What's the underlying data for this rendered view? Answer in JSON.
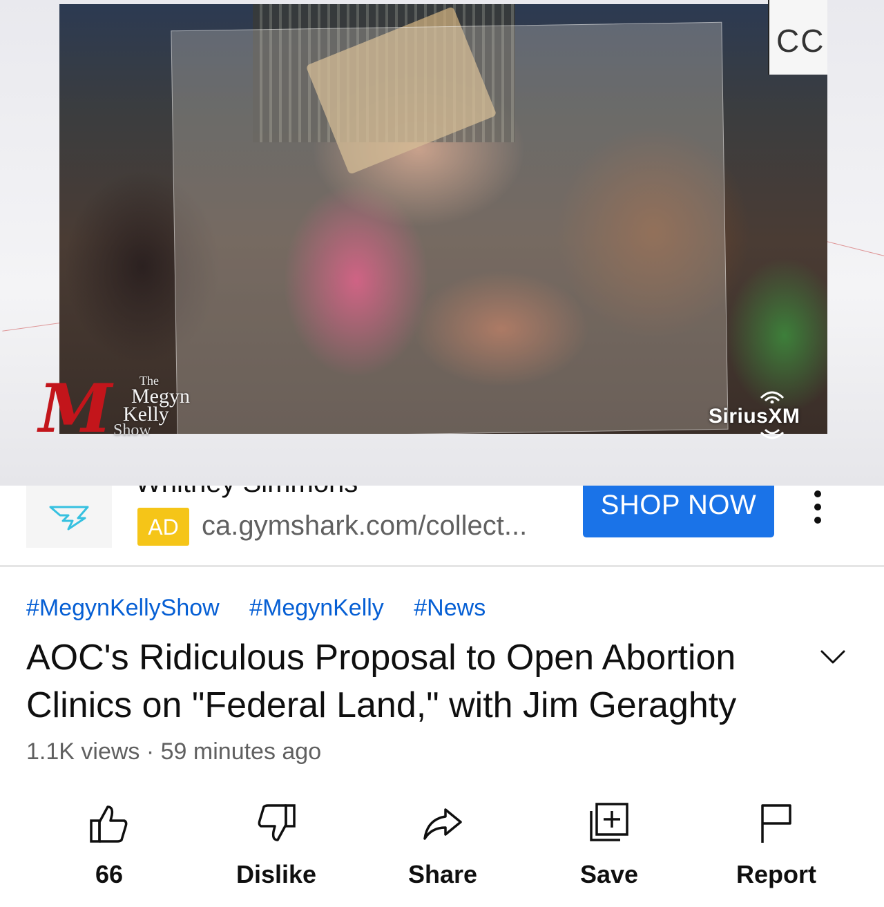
{
  "video": {
    "watermark_logo": {
      "line1": "The",
      "line2": "Megyn",
      "line3": "Kelly",
      "line4": "Show"
    },
    "network_logo": "SiriusXM",
    "background_sign_text": "CC"
  },
  "ad": {
    "advertiser_title": "Whitney Simmons",
    "badge": "AD",
    "url": "ca.gymshark.com/collect...",
    "cta_label": "SHOP NOW",
    "brand_color": "#1a73e8",
    "badge_color": "#f5c518",
    "logo_icon": "gymshark-logo-icon",
    "menu_icon": "more-vertical-icon"
  },
  "hashtags": [
    "#MegynKellyShow",
    "#MegynKelly",
    "#News"
  ],
  "title": "AOC's Ridiculous Proposal to Open Abortion Clinics on \"Federal Land,\" with Jim Geraghty",
  "expand_icon": "chevron-down-icon",
  "stats": {
    "views": "1.1K views",
    "separator": "·",
    "age": "59 minutes ago"
  },
  "actions": [
    {
      "label": "66",
      "icon": "thumbs-up-icon"
    },
    {
      "label": "Dislike",
      "icon": "thumbs-down-icon"
    },
    {
      "label": "Share",
      "icon": "share-arrow-icon"
    },
    {
      "label": "Save",
      "icon": "playlist-add-icon"
    },
    {
      "label": "Report",
      "icon": "flag-icon"
    }
  ]
}
